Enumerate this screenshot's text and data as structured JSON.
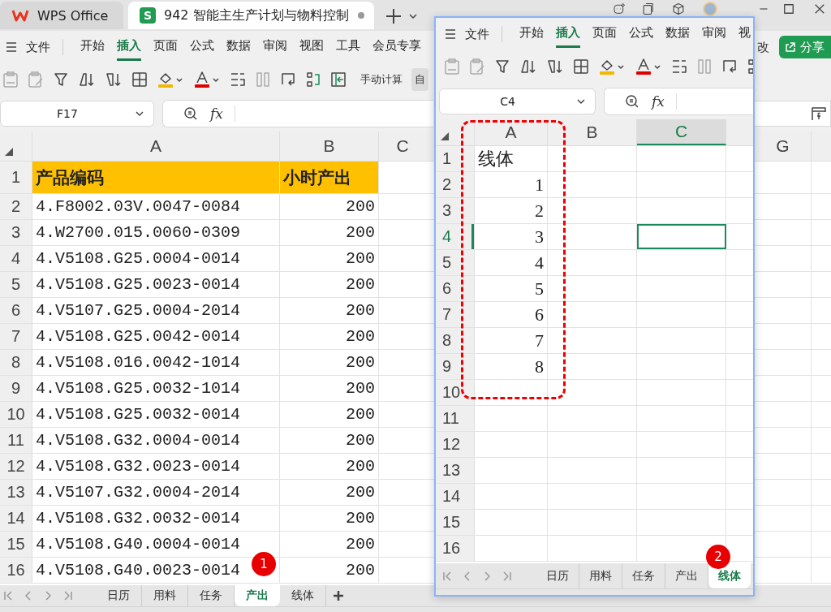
{
  "title_bar": {
    "tabs": [
      {
        "kind": "home",
        "label": "WPS Office",
        "selected": false
      },
      {
        "kind": "document",
        "label": "942 智能主生产计划与物料控制",
        "icon_letter": "S",
        "selected": true
      }
    ]
  },
  "main_window": {
    "menu": {
      "file": "文件",
      "items": [
        {
          "label": "开始",
          "selected": false
        },
        {
          "label": "插入",
          "selected": true
        },
        {
          "label": "页面",
          "selected": false
        },
        {
          "label": "公式",
          "selected": false
        },
        {
          "label": "数据",
          "selected": false
        },
        {
          "label": "审阅",
          "selected": false
        },
        {
          "label": "视图",
          "selected": false
        },
        {
          "label": "工具",
          "selected": false
        },
        {
          "label": "会员专享",
          "selected": false
        }
      ]
    },
    "edit_label": "改",
    "share_button": "分享",
    "toolbar": {
      "calc_label": "手动计算",
      "partial_button": "自"
    },
    "name_box": "F17",
    "function_label": "fx",
    "columns": [
      "A",
      "B",
      "C",
      "G"
    ],
    "rows": [
      {
        "number": "1",
        "header": true,
        "cells": [
          "产品编码",
          "小时产出"
        ]
      },
      {
        "number": "2",
        "header": false,
        "cells": [
          "4.F8002.03V.0047-0084",
          "200"
        ]
      },
      {
        "number": "3",
        "header": false,
        "cells": [
          "4.W2700.015.0060-0309",
          "200"
        ]
      },
      {
        "number": "4",
        "header": false,
        "cells": [
          "4.V5108.G25.0004-0014",
          "200"
        ]
      },
      {
        "number": "5",
        "header": false,
        "cells": [
          "4.V5108.G25.0023-0014",
          "200"
        ]
      },
      {
        "number": "6",
        "header": false,
        "cells": [
          "4.V5107.G25.0004-2014",
          "200"
        ]
      },
      {
        "number": "7",
        "header": false,
        "cells": [
          "4.V5108.G25.0042-0014",
          "200"
        ]
      },
      {
        "number": "8",
        "header": false,
        "cells": [
          "4.V5108.016.0042-1014",
          "200"
        ]
      },
      {
        "number": "9",
        "header": false,
        "cells": [
          "4.V5108.G25.0032-1014",
          "200"
        ]
      },
      {
        "number": "10",
        "header": false,
        "cells": [
          "4.V5108.G25.0032-0014",
          "200"
        ]
      },
      {
        "number": "11",
        "header": false,
        "cells": [
          "4.V5108.G32.0004-0014",
          "200"
        ]
      },
      {
        "number": "12",
        "header": false,
        "cells": [
          "4.V5108.G32.0023-0014",
          "200"
        ]
      },
      {
        "number": "13",
        "header": false,
        "cells": [
          "4.V5107.G32.0004-2014",
          "200"
        ]
      },
      {
        "number": "14",
        "header": false,
        "cells": [
          "4.V5108.G32.0032-0014",
          "200"
        ]
      },
      {
        "number": "15",
        "header": false,
        "cells": [
          "4.V5108.G40.0004-0014",
          "200"
        ]
      },
      {
        "number": "16",
        "header": false,
        "cells": [
          "4.V5108.G40.0023-0014",
          "200"
        ]
      }
    ],
    "sheets": [
      {
        "label": "日历",
        "selected": false
      },
      {
        "label": "用料",
        "selected": false
      },
      {
        "label": "任务",
        "selected": false
      },
      {
        "label": "产出",
        "selected": true
      },
      {
        "label": "线体",
        "selected": false
      }
    ],
    "badge": "1"
  },
  "overlay_window": {
    "menu": {
      "file": "文件",
      "items": [
        {
          "label": "开始",
          "selected": false
        },
        {
          "label": "插入",
          "selected": true
        },
        {
          "label": "页面",
          "selected": false
        },
        {
          "label": "公式",
          "selected": false
        },
        {
          "label": "数据",
          "selected": false
        },
        {
          "label": "审阅",
          "selected": false
        },
        {
          "label": "视",
          "selected": false
        }
      ]
    },
    "name_box": "C4",
    "function_label": "fx",
    "columns": [
      {
        "label": "A",
        "selected": false
      },
      {
        "label": "B",
        "selected": false
      },
      {
        "label": "C",
        "selected": true
      }
    ],
    "rows": [
      {
        "number": "1",
        "selected": false,
        "cells": [
          "线体"
        ]
      },
      {
        "number": "2",
        "selected": false,
        "cells": [
          "1"
        ]
      },
      {
        "number": "3",
        "selected": false,
        "cells": [
          "2"
        ]
      },
      {
        "number": "4",
        "selected": true,
        "cells": [
          "3"
        ]
      },
      {
        "number": "5",
        "selected": false,
        "cells": [
          "4"
        ]
      },
      {
        "number": "6",
        "selected": false,
        "cells": [
          "5"
        ]
      },
      {
        "number": "7",
        "selected": false,
        "cells": [
          "6"
        ]
      },
      {
        "number": "8",
        "selected": false,
        "cells": [
          "7"
        ]
      },
      {
        "number": "9",
        "selected": false,
        "cells": [
          "8"
        ]
      },
      {
        "number": "10",
        "selected": false
      },
      {
        "number": "11",
        "selected": false
      },
      {
        "number": "12",
        "selected": false
      },
      {
        "number": "13",
        "selected": false
      },
      {
        "number": "14",
        "selected": false
      },
      {
        "number": "15",
        "selected": false
      },
      {
        "number": "16",
        "selected": false
      }
    ],
    "sheets": [
      {
        "label": "日历",
        "selected": false
      },
      {
        "label": "用料",
        "selected": false
      },
      {
        "label": "任务",
        "selected": false
      },
      {
        "label": "产出",
        "selected": false
      },
      {
        "label": "线体",
        "selected": true
      }
    ],
    "badge": "2"
  }
}
